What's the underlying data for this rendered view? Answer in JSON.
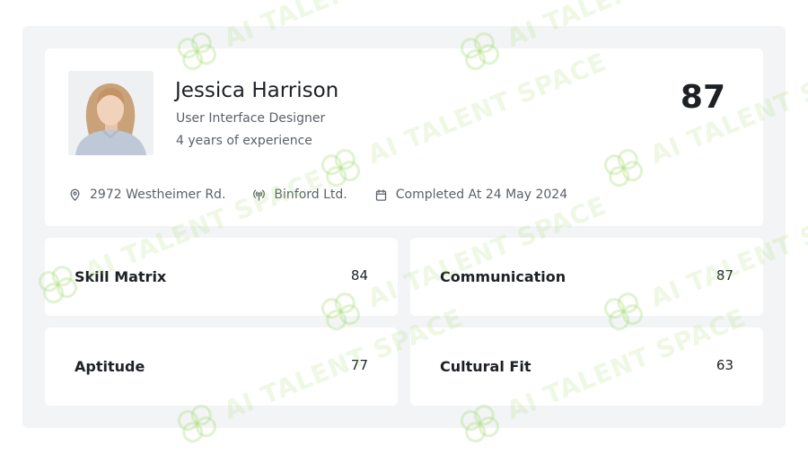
{
  "profile": {
    "name": "Jessica Harrison",
    "role": "User Interface Designer",
    "experience": "4 years of experience",
    "overall_score": "87",
    "meta": {
      "address": "2972 Westheimer Rd.",
      "company": "Binford Ltd.",
      "completed": "Completed At 24 May 2024"
    }
  },
  "scores": [
    {
      "label": "Skill Matrix",
      "value": "84"
    },
    {
      "label": "Communication",
      "value": "87"
    },
    {
      "label": "Aptitude",
      "value": "77"
    },
    {
      "label": "Cultural Fit",
      "value": "63"
    }
  ],
  "watermark_text": "AI TALENT SPACE",
  "colors": {
    "frame_bg": "#f3f4f6",
    "card_bg": "#ffffff",
    "text_primary": "#1d2125",
    "text_secondary": "#5b6168",
    "watermark": "#aadc78"
  },
  "icons": {
    "address": "map-pin-icon",
    "company": "broadcast-icon",
    "completed": "calendar-icon"
  }
}
